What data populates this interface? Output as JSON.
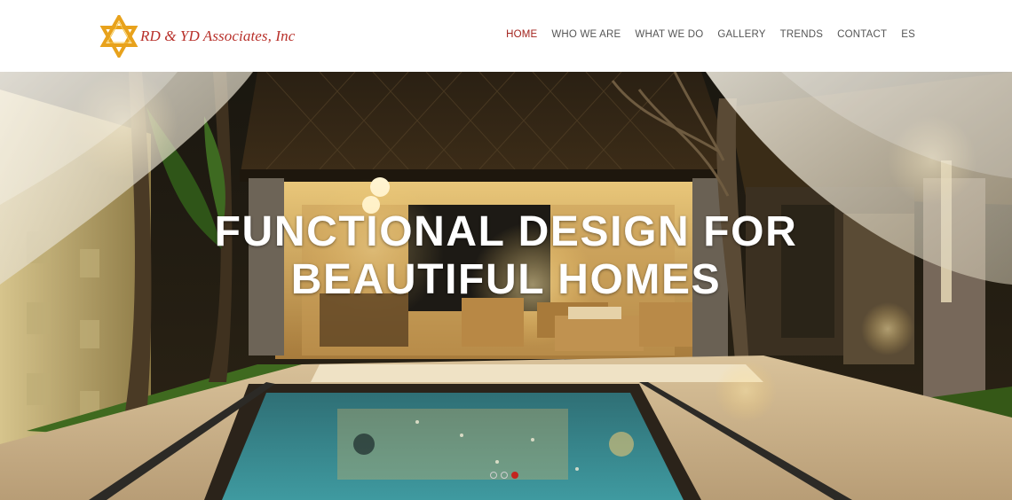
{
  "brand": {
    "name": "RD & YD Associates, Inc",
    "star_color": "#e8a21c",
    "text_color": "#b8302a"
  },
  "nav": {
    "items": [
      {
        "label": "HOME",
        "active": true
      },
      {
        "label": "WHO WE ARE",
        "active": false
      },
      {
        "label": "WHAT WE DO",
        "active": false
      },
      {
        "label": "GALLERY",
        "active": false
      },
      {
        "label": "TRENDS",
        "active": false
      },
      {
        "label": "CONTACT",
        "active": false
      },
      {
        "label": "ES",
        "active": false
      }
    ],
    "active_color": "#a2221c"
  },
  "hero": {
    "headline_line1": "FUNCTIONAL DESIGN FOR",
    "headline_line2": "BEAUTIFUL HOMES",
    "slides": 3,
    "active_slide": 3,
    "dot_active_color": "#c3241f"
  }
}
